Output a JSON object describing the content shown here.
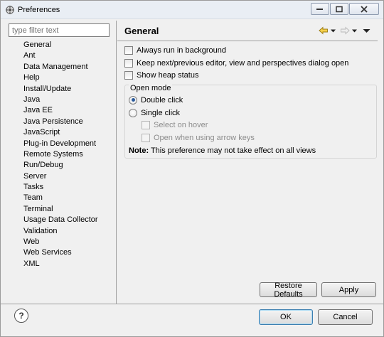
{
  "window": {
    "title": "Preferences",
    "controls": [
      "minimize-icon",
      "restore-icon",
      "close-icon"
    ]
  },
  "filter": {
    "placeholder": "type filter text"
  },
  "tree": {
    "items": [
      "General",
      "Ant",
      "Data Management",
      "Help",
      "Install/Update",
      "Java",
      "Java EE",
      "Java Persistence",
      "JavaScript",
      "Plug-in Development",
      "Remote Systems",
      "Run/Debug",
      "Server",
      "Tasks",
      "Team",
      "Terminal",
      "Usage Data Collector",
      "Validation",
      "Web",
      "Web Services",
      "XML"
    ],
    "selected": "General"
  },
  "page": {
    "title": "General",
    "nav_icons": [
      "back-arrow-icon",
      "back-dropdown-icon",
      "forward-arrow-icon",
      "forward-dropdown-icon",
      "view-menu-icon"
    ]
  },
  "options": {
    "always_background": {
      "label": "Always run in background",
      "checked": false
    },
    "keep_next_prev": {
      "label": "Keep next/previous editor, view and perspectives dialog open",
      "checked": false
    },
    "show_heap": {
      "label": "Show heap status",
      "checked": false
    }
  },
  "open_mode": {
    "title": "Open mode",
    "double_click": "Double click",
    "single_click": "Single click",
    "selected": "Double click",
    "select_on_hover": "Select on hover",
    "open_arrow_keys": "Open when using arrow keys",
    "note_label": "Note:",
    "note_text": " This preference may not take effect on all views"
  },
  "buttons": {
    "restore_defaults": "Restore Defaults",
    "apply": "Apply",
    "ok": "OK",
    "cancel": "Cancel",
    "help": "?"
  }
}
